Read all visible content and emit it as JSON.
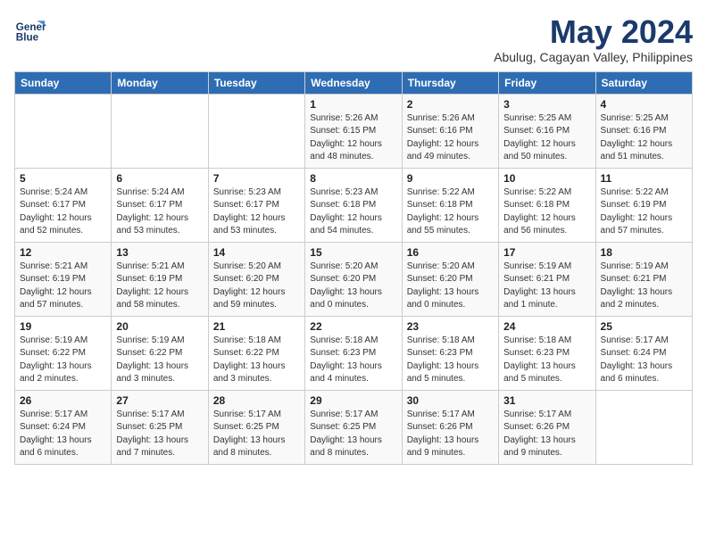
{
  "header": {
    "logo_line1": "General",
    "logo_line2": "Blue",
    "title": "May 2024",
    "location": "Abulug, Cagayan Valley, Philippines"
  },
  "weekdays": [
    "Sunday",
    "Monday",
    "Tuesday",
    "Wednesday",
    "Thursday",
    "Friday",
    "Saturday"
  ],
  "weeks": [
    [
      {
        "day": "",
        "info": ""
      },
      {
        "day": "",
        "info": ""
      },
      {
        "day": "",
        "info": ""
      },
      {
        "day": "1",
        "info": "Sunrise: 5:26 AM\nSunset: 6:15 PM\nDaylight: 12 hours\nand 48 minutes."
      },
      {
        "day": "2",
        "info": "Sunrise: 5:26 AM\nSunset: 6:16 PM\nDaylight: 12 hours\nand 49 minutes."
      },
      {
        "day": "3",
        "info": "Sunrise: 5:25 AM\nSunset: 6:16 PM\nDaylight: 12 hours\nand 50 minutes."
      },
      {
        "day": "4",
        "info": "Sunrise: 5:25 AM\nSunset: 6:16 PM\nDaylight: 12 hours\nand 51 minutes."
      }
    ],
    [
      {
        "day": "5",
        "info": "Sunrise: 5:24 AM\nSunset: 6:17 PM\nDaylight: 12 hours\nand 52 minutes."
      },
      {
        "day": "6",
        "info": "Sunrise: 5:24 AM\nSunset: 6:17 PM\nDaylight: 12 hours\nand 53 minutes."
      },
      {
        "day": "7",
        "info": "Sunrise: 5:23 AM\nSunset: 6:17 PM\nDaylight: 12 hours\nand 53 minutes."
      },
      {
        "day": "8",
        "info": "Sunrise: 5:23 AM\nSunset: 6:18 PM\nDaylight: 12 hours\nand 54 minutes."
      },
      {
        "day": "9",
        "info": "Sunrise: 5:22 AM\nSunset: 6:18 PM\nDaylight: 12 hours\nand 55 minutes."
      },
      {
        "day": "10",
        "info": "Sunrise: 5:22 AM\nSunset: 6:18 PM\nDaylight: 12 hours\nand 56 minutes."
      },
      {
        "day": "11",
        "info": "Sunrise: 5:22 AM\nSunset: 6:19 PM\nDaylight: 12 hours\nand 57 minutes."
      }
    ],
    [
      {
        "day": "12",
        "info": "Sunrise: 5:21 AM\nSunset: 6:19 PM\nDaylight: 12 hours\nand 57 minutes."
      },
      {
        "day": "13",
        "info": "Sunrise: 5:21 AM\nSunset: 6:19 PM\nDaylight: 12 hours\nand 58 minutes."
      },
      {
        "day": "14",
        "info": "Sunrise: 5:20 AM\nSunset: 6:20 PM\nDaylight: 12 hours\nand 59 minutes."
      },
      {
        "day": "15",
        "info": "Sunrise: 5:20 AM\nSunset: 6:20 PM\nDaylight: 13 hours\nand 0 minutes."
      },
      {
        "day": "16",
        "info": "Sunrise: 5:20 AM\nSunset: 6:20 PM\nDaylight: 13 hours\nand 0 minutes."
      },
      {
        "day": "17",
        "info": "Sunrise: 5:19 AM\nSunset: 6:21 PM\nDaylight: 13 hours\nand 1 minute."
      },
      {
        "day": "18",
        "info": "Sunrise: 5:19 AM\nSunset: 6:21 PM\nDaylight: 13 hours\nand 2 minutes."
      }
    ],
    [
      {
        "day": "19",
        "info": "Sunrise: 5:19 AM\nSunset: 6:22 PM\nDaylight: 13 hours\nand 2 minutes."
      },
      {
        "day": "20",
        "info": "Sunrise: 5:19 AM\nSunset: 6:22 PM\nDaylight: 13 hours\nand 3 minutes."
      },
      {
        "day": "21",
        "info": "Sunrise: 5:18 AM\nSunset: 6:22 PM\nDaylight: 13 hours\nand 3 minutes."
      },
      {
        "day": "22",
        "info": "Sunrise: 5:18 AM\nSunset: 6:23 PM\nDaylight: 13 hours\nand 4 minutes."
      },
      {
        "day": "23",
        "info": "Sunrise: 5:18 AM\nSunset: 6:23 PM\nDaylight: 13 hours\nand 5 minutes."
      },
      {
        "day": "24",
        "info": "Sunrise: 5:18 AM\nSunset: 6:23 PM\nDaylight: 13 hours\nand 5 minutes."
      },
      {
        "day": "25",
        "info": "Sunrise: 5:17 AM\nSunset: 6:24 PM\nDaylight: 13 hours\nand 6 minutes."
      }
    ],
    [
      {
        "day": "26",
        "info": "Sunrise: 5:17 AM\nSunset: 6:24 PM\nDaylight: 13 hours\nand 6 minutes."
      },
      {
        "day": "27",
        "info": "Sunrise: 5:17 AM\nSunset: 6:25 PM\nDaylight: 13 hours\nand 7 minutes."
      },
      {
        "day": "28",
        "info": "Sunrise: 5:17 AM\nSunset: 6:25 PM\nDaylight: 13 hours\nand 8 minutes."
      },
      {
        "day": "29",
        "info": "Sunrise: 5:17 AM\nSunset: 6:25 PM\nDaylight: 13 hours\nand 8 minutes."
      },
      {
        "day": "30",
        "info": "Sunrise: 5:17 AM\nSunset: 6:26 PM\nDaylight: 13 hours\nand 9 minutes."
      },
      {
        "day": "31",
        "info": "Sunrise: 5:17 AM\nSunset: 6:26 PM\nDaylight: 13 hours\nand 9 minutes."
      },
      {
        "day": "",
        "info": ""
      }
    ]
  ]
}
